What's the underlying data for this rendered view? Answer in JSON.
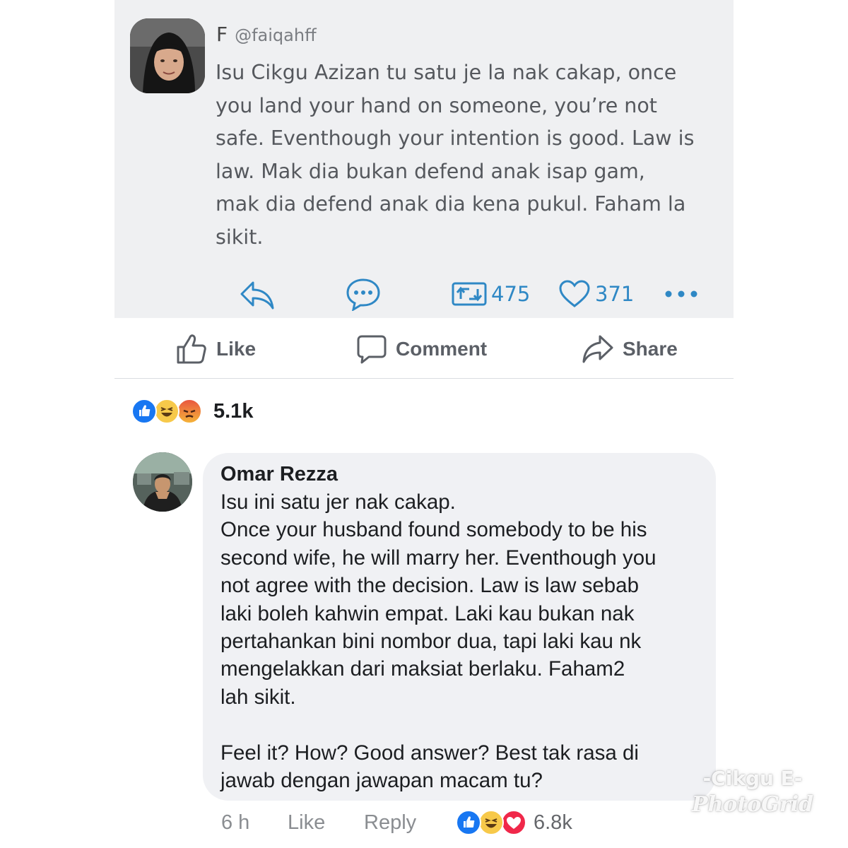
{
  "tweet": {
    "name": "F",
    "handle": "@faiqahff",
    "text": "Isu Cikgu Azizan tu satu je la nak cakap, once\nyou land your hand on someone, you’re not\nsafe. Eventhough your intention is good. Law is\nlaw. Mak dia bukan defend anak isap gam,\nmak dia defend anak dia kena pukul. Faham la\nsikit.",
    "actions": {
      "reply_icon": "reply-arrow-icon",
      "dm_icon": "speech-bubble-icon",
      "retweet_icon": "retweet-icon",
      "retweet_count": "475",
      "like_icon": "heart-outline-icon",
      "like_count": "371",
      "more_icon": "ellipsis-icon"
    },
    "accent_color": "#2f88c5"
  },
  "fb_actions": {
    "like_label": "Like",
    "comment_label": "Comment",
    "share_label": "Share"
  },
  "post_reactions": {
    "types": [
      "like",
      "haha",
      "angry"
    ],
    "count": "5.1k"
  },
  "comment": {
    "author": "Omar Rezza",
    "text": "Isu ini satu jer nak cakap.\nOnce your husband found somebody to be his\nsecond wife, he will marry her. Eventhough you\nnot agree with the decision. Law is law sebab\nlaki boleh kahwin empat. Laki kau bukan nak\npertahankan bini nombor dua, tapi laki kau nk\nmengelakkan dari maksiat berlaku. Faham2\nlah sikit.\n\nFeel it? How? Good answer? Best tak rasa di\njawab dengan jawapan macam tu?",
    "time": "6 h",
    "like_label": "Like",
    "reply_label": "Reply",
    "reaction_types": [
      "like",
      "haha",
      "love"
    ],
    "reaction_count": "6.8k"
  },
  "watermark": {
    "line1": "-Cikgu E-",
    "line2": "PhotoGrid"
  }
}
